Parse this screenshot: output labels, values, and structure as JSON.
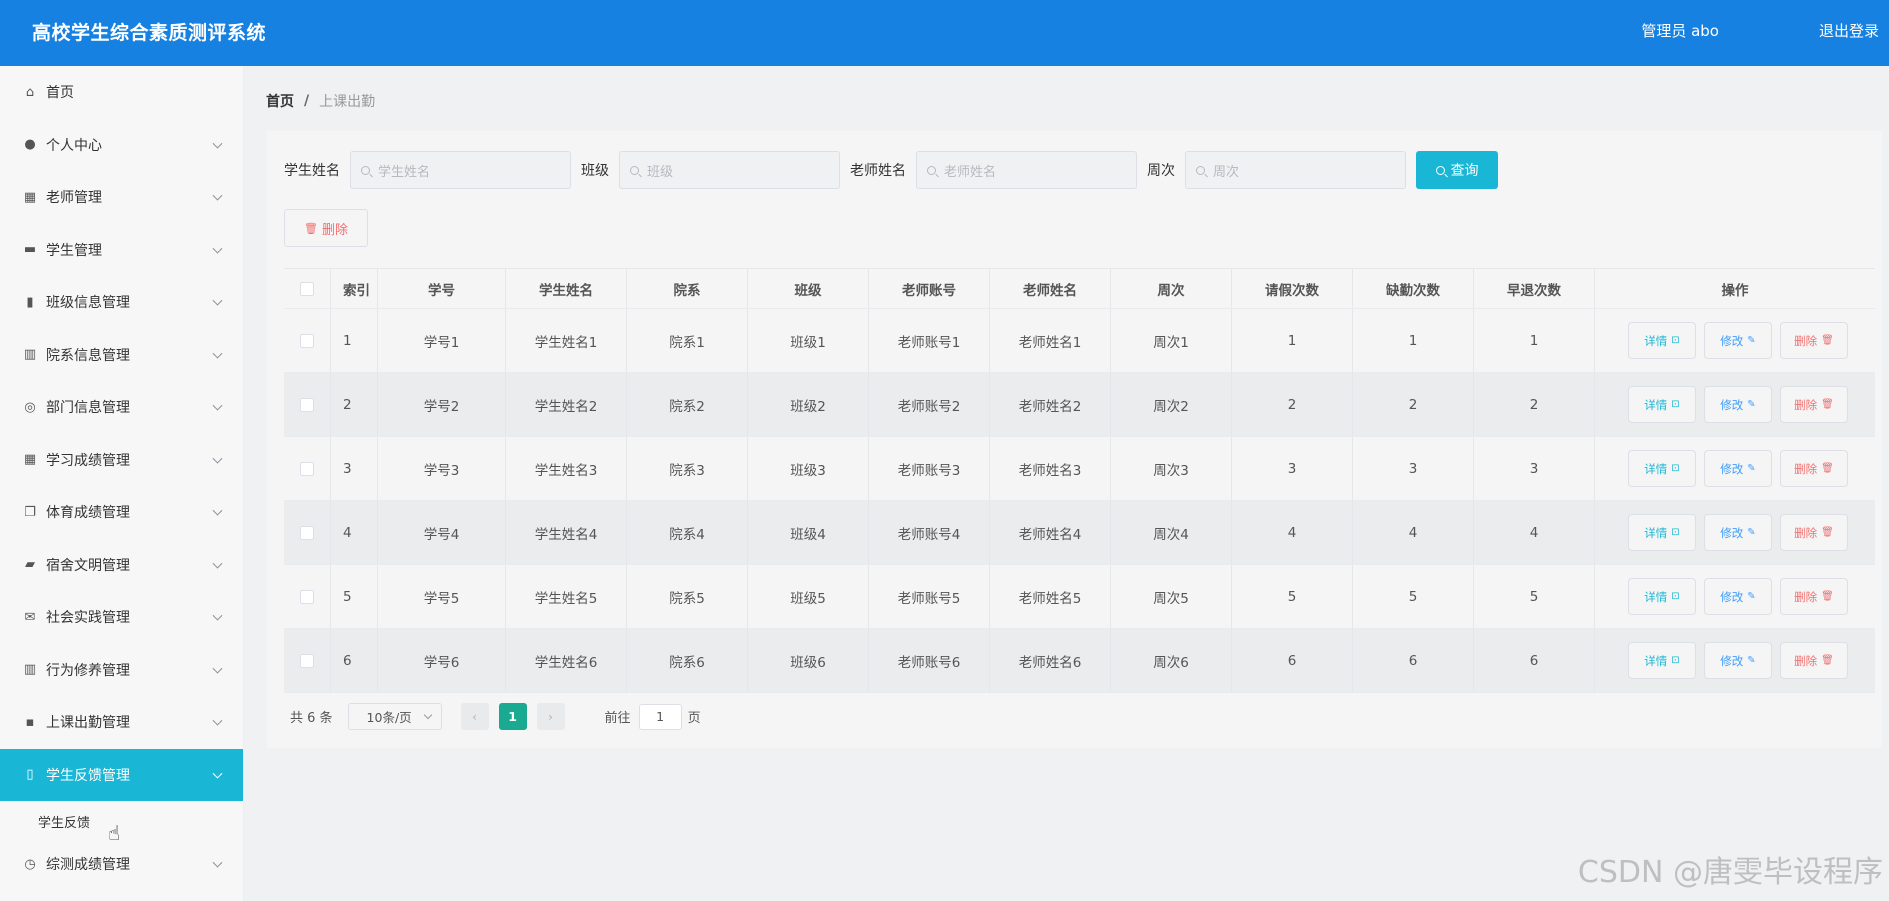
{
  "header": {
    "title": "高校学生综合素质测评系统",
    "user": "管理员 abo",
    "logout": "退出登录"
  },
  "sidebar": {
    "items": [
      {
        "label": "首页",
        "icon": "home-icon",
        "glyph": "⌂",
        "has_arrow": false
      },
      {
        "label": "个人中心",
        "icon": "user-icon",
        "glyph": "●",
        "has_arrow": true
      },
      {
        "label": "老师管理",
        "icon": "grid-icon",
        "glyph": "▦",
        "has_arrow": true
      },
      {
        "label": "学生管理",
        "icon": "briefcase-icon",
        "glyph": "▬",
        "has_arrow": true
      },
      {
        "label": "班级信息管理",
        "icon": "clipboard-icon",
        "glyph": "▮",
        "has_arrow": true
      },
      {
        "label": "院系信息管理",
        "icon": "bar-chart-icon",
        "glyph": "▥",
        "has_arrow": true
      },
      {
        "label": "部门信息管理",
        "icon": "compass-icon",
        "glyph": "◎",
        "has_arrow": true
      },
      {
        "label": "学习成绩管理",
        "icon": "dashboard-icon",
        "glyph": "▦",
        "has_arrow": true
      },
      {
        "label": "体育成绩管理",
        "icon": "copy-icon",
        "glyph": "❐",
        "has_arrow": true
      },
      {
        "label": "宿舍文明管理",
        "icon": "ticket-icon",
        "glyph": "▰",
        "has_arrow": true
      },
      {
        "label": "社会实践管理",
        "icon": "mail-icon",
        "glyph": "✉",
        "has_arrow": true
      },
      {
        "label": "行为修养管理",
        "icon": "chart-icon",
        "glyph": "▥",
        "has_arrow": true
      },
      {
        "label": "上课出勤管理",
        "icon": "chat-icon",
        "glyph": "▪",
        "has_arrow": true
      }
    ],
    "active_item": {
      "label": "学生反馈管理",
      "icon": "feedback-icon",
      "glyph": "▯"
    },
    "submenu": {
      "label": "学生反馈"
    },
    "last_item": {
      "label": "综测成绩管理",
      "icon": "clock-icon",
      "glyph": "◷"
    }
  },
  "breadcrumb": {
    "home": "首页",
    "sep": "/",
    "current": "上课出勤"
  },
  "search": {
    "fields": [
      {
        "label": "学生姓名",
        "placeholder": "学生姓名"
      },
      {
        "label": "班级",
        "placeholder": "班级"
      },
      {
        "label": "老师姓名",
        "placeholder": "老师姓名"
      },
      {
        "label": "周次",
        "placeholder": "周次"
      }
    ],
    "query_label": "查询"
  },
  "toolbar": {
    "delete_label": "删除",
    "delete_icon": "🗑"
  },
  "table": {
    "headers": [
      "索引",
      "学号",
      "学生姓名",
      "院系",
      "班级",
      "老师账号",
      "老师姓名",
      "周次",
      "请假次数",
      "缺勤次数",
      "早退次数",
      "操作"
    ],
    "rows": [
      [
        "1",
        "学号1",
        "学生姓名1",
        "院系1",
        "班级1",
        "老师账号1",
        "老师姓名1",
        "周次1",
        "1",
        "1",
        "1"
      ],
      [
        "2",
        "学号2",
        "学生姓名2",
        "院系2",
        "班级2",
        "老师账号2",
        "老师姓名2",
        "周次2",
        "2",
        "2",
        "2"
      ],
      [
        "3",
        "学号3",
        "学生姓名3",
        "院系3",
        "班级3",
        "老师账号3",
        "老师姓名3",
        "周次3",
        "3",
        "3",
        "3"
      ],
      [
        "4",
        "学号4",
        "学生姓名4",
        "院系4",
        "班级4",
        "老师账号4",
        "老师姓名4",
        "周次4",
        "4",
        "4",
        "4"
      ],
      [
        "5",
        "学号5",
        "学生姓名5",
        "院系5",
        "班级5",
        "老师账号5",
        "老师姓名5",
        "周次5",
        "5",
        "5",
        "5"
      ],
      [
        "6",
        "学号6",
        "学生姓名6",
        "院系6",
        "班级6",
        "老师账号6",
        "老师姓名6",
        "周次6",
        "6",
        "6",
        "6"
      ]
    ],
    "actions": {
      "detail": "详情",
      "edit": "修改",
      "delete": "删除",
      "detail_icon": "⊡",
      "edit_icon": "✎",
      "delete_icon": "🗑"
    }
  },
  "pagination": {
    "total": "共 6 条",
    "page_size": "10条/页",
    "prev": "‹",
    "next": "›",
    "current_page": "1",
    "goto_label": "前往",
    "goto_value": "1",
    "page_suffix": "页"
  },
  "watermark": "CSDN @唐雯毕设程序",
  "colors": {
    "header": "#1681e0",
    "accent": "#1ab6d6",
    "danger": "#f56c6c",
    "page_active": "#1aaa91"
  }
}
